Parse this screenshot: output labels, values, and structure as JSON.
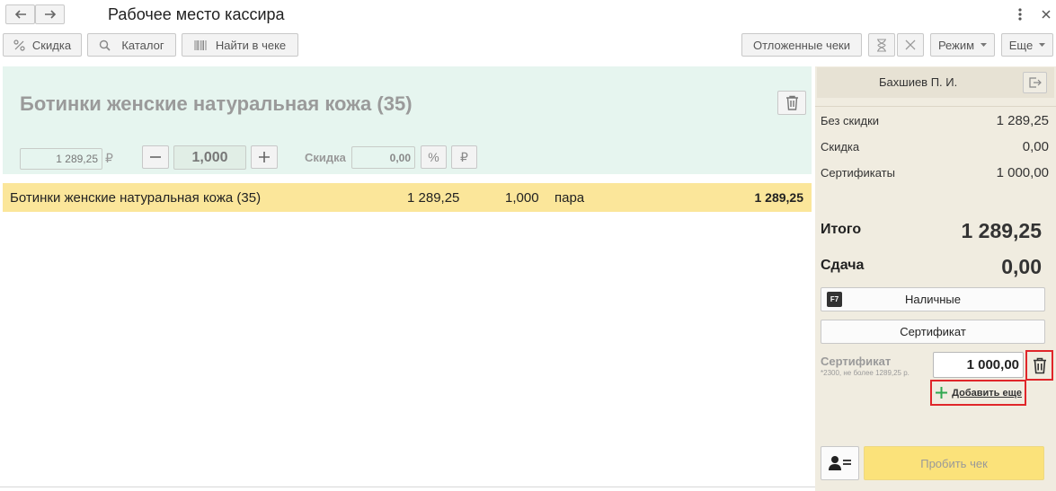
{
  "window": {
    "title": "Рабочее место кассира"
  },
  "toolbar": {
    "discount_label": "Скидка",
    "catalog_label": "Каталог",
    "find_in_receipt_label": "Найти в чеке",
    "deferred_receipts_label": "Отложенные чеки",
    "mode_label": "Режим",
    "more_label": "Еще"
  },
  "product_panel": {
    "title": "Ботинки женские натуральная кожа (35)",
    "price": "1 289,25",
    "currency": "₽",
    "quantity": "1,000",
    "discount_label": "Скидка",
    "discount_value": "0,00",
    "percent_symbol": "%",
    "ruble_symbol": "₽"
  },
  "receipt": {
    "rows": [
      {
        "name": "Ботинки женские натуральная кожа (35)",
        "price": "1 289,25",
        "quantity": "1,000",
        "unit": "пара",
        "sum": "1 289,25"
      }
    ]
  },
  "sidebar": {
    "cashier": "Бахшиев П. И.",
    "summary": [
      {
        "label": "Без скидки",
        "value": "1 289,25"
      },
      {
        "label": "Скидка",
        "value": "0,00"
      },
      {
        "label": "Сертификаты",
        "value": "1 000,00"
      }
    ],
    "total_label": "Итого",
    "total_value": "1 289,25",
    "change_label": "Сдача",
    "change_value": "0,00",
    "cash_hotkey": "F7",
    "cash_label": "Наличные",
    "certificate_button_label": "Сертификат",
    "certificate_label": "Сертификат",
    "certificate_note": "*2300, не более 1289,25 р.",
    "certificate_amount": "1 000,00",
    "add_more_label": "Добавить еще",
    "print_receipt_label": "Пробить чек"
  },
  "colors": {
    "product_panel_bg": "#e6f5ef",
    "selected_row_bg": "#fbe69a",
    "sidebar_bg": "#f0ece0",
    "print_button_bg": "#fbe27a",
    "highlight_red": "#e0262a",
    "add_icon_green": "#2fa84f"
  }
}
